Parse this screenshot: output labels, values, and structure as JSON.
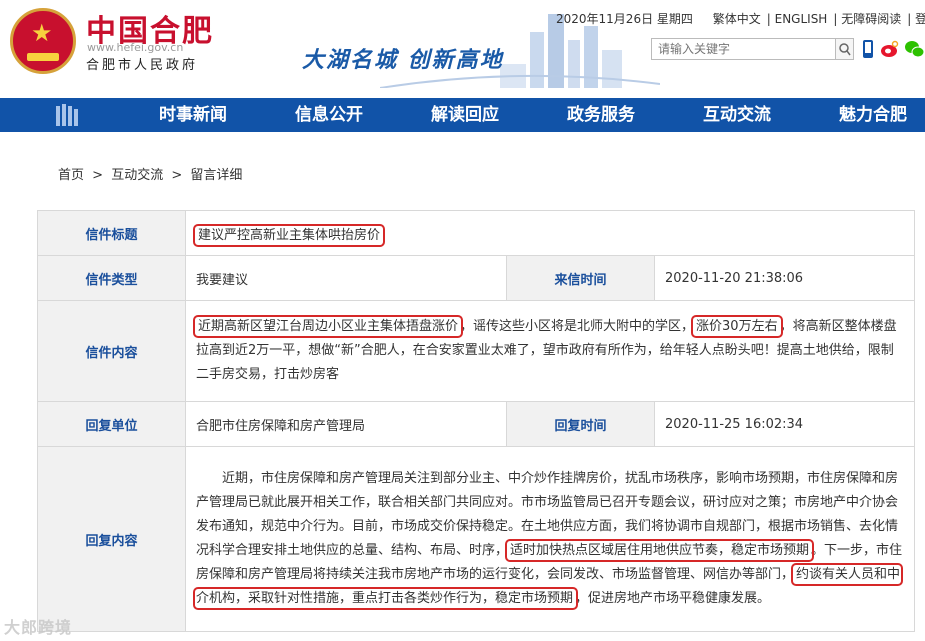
{
  "header": {
    "logo_text": "中国合肥",
    "url": "www.hefei.gov.cn",
    "sub_title": "合肥市人民政府",
    "slogan": "大湖名城 创新高地",
    "date": "2020年11月26日 星期四",
    "links": [
      "繁体中文",
      "ENGLISH",
      "无障碍阅读",
      "登"
    ],
    "search_placeholder": "请输入关键字"
  },
  "nav": {
    "items": [
      "时事新闻",
      "信息公开",
      "解读回应",
      "政务服务",
      "互动交流",
      "魅力合肥"
    ]
  },
  "breadcrumb": [
    "首页",
    "互动交流",
    "留言详细"
  ],
  "breadcrumb_sep": ">",
  "letter": {
    "title_label": "信件标题",
    "title": "建议严控高新业主集体哄抬房价",
    "type_label": "信件类型",
    "type": "我要建议",
    "time_label": "来信时间",
    "time": "2020-11-20 21:38:06",
    "content_label": "信件内容",
    "content_parts": [
      "近期高新区望江台周边小区业主集体捂盘涨价",
      "，谣传这些小区将是北师大附中的学区，",
      "涨价30万左右",
      "，将高新区整体楼盘拉高到近2万一平，想做“新”合肥人，在合安家置业太难了，望市政府有所作为，给年轻人点盼头吧！提高土地供给，限制二手房交易，打击炒房客"
    ],
    "reply_unit_label": "回复单位",
    "reply_unit": "合肥市住房保障和房产管理局",
    "reply_time_label": "回复时间",
    "reply_time": "2020-11-25 16:02:34",
    "reply_content_label": "回复内容",
    "reply_parts": [
      "近期，市住房保障和房产管理局关注到部分业主、中介炒作挂牌房价，扰乱市场秩序，影响市场预期，市住房保障和房产管理局已就此展开相关工作，联合相关部门共同应对。市市场监管局已召开专题会议，研讨应对之策；市房地产中介协会发布通知，规范中介行为。目前，市场成交价保持稳定。在土地供应方面，我们将协调市自规部门，根据市场销售、去化情况科学合理安排土地供应的总量、结构、布局、时序，",
      "适时加快热点区域居住用地供应节奏，稳定市场预期",
      "。下一步，市住房保障和房产管理局将持续关注我市房地产市场的运行变化，会同发改、市场监督管理、网信办等部门，",
      "约谈有关人员和中介机构，采取针对性措施，重点打击各类炒作行为，稳定市场预期",
      "，促进房地产市场平稳健康发展。"
    ]
  },
  "watermark": "大郎跨境"
}
